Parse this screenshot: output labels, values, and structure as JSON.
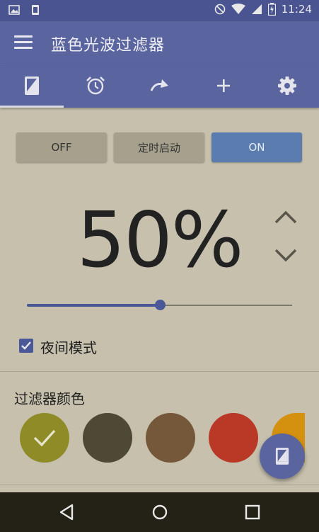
{
  "status_bar": {
    "left_icons": [
      "image-icon",
      "sim-icon"
    ],
    "right_icons": [
      "do-not-disturb-icon",
      "wifi-icon",
      "signal-icon",
      "battery-charging-icon"
    ],
    "time": "11:24"
  },
  "app_bar": {
    "menu_icon": "hamburger-menu-icon",
    "title": "蓝色光波过滤器"
  },
  "tabs": [
    {
      "icon": "phone-filter-icon",
      "active": true
    },
    {
      "icon": "alarm-clock-icon",
      "active": false
    },
    {
      "icon": "redo-arrow-icon",
      "active": false
    },
    {
      "icon": "plus-icon",
      "active": false
    },
    {
      "icon": "gear-icon",
      "active": false
    }
  ],
  "mode_buttons": {
    "off": "OFF",
    "timer": "定时启动",
    "on": "ON",
    "selected": "ON"
  },
  "opacity": {
    "display": "50%",
    "value_percent": 50,
    "up_icon": "chevron-up-icon",
    "down_icon": "chevron-down-icon"
  },
  "night_mode": {
    "label": "夜间模式",
    "checked": true
  },
  "filter_color": {
    "title": "过滤器颜色",
    "swatches": [
      {
        "color": "#8f8c28",
        "selected": true
      },
      {
        "color": "#4e4935",
        "selected": false
      },
      {
        "color": "#755839",
        "selected": false
      },
      {
        "color": "#b93826",
        "selected": false
      },
      {
        "color": "#d4900f",
        "selected": false
      }
    ]
  },
  "fab": {
    "icon": "phone-filter-icon"
  },
  "nav_bar": {
    "back_icon": "back-triangle-icon",
    "home_icon": "home-circle-icon",
    "recents_icon": "recents-square-icon"
  },
  "colors": {
    "primary": "#5a649e",
    "primary_dark": "#4a5490",
    "accent": "#4a5898",
    "background": "#c6c0ac"
  }
}
